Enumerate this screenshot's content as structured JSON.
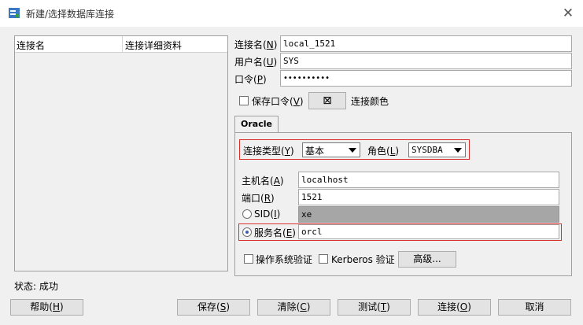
{
  "window": {
    "title": "新建/选择数据库连接",
    "close_glyph": "✕"
  },
  "connections_list": {
    "columns": [
      "连接名",
      "连接详细资料"
    ]
  },
  "form": {
    "conn_name": {
      "label": "连接名",
      "key": "N",
      "value": "local_1521"
    },
    "user_name": {
      "label": "用户名",
      "key": "U",
      "value": "SYS"
    },
    "password": {
      "label": "口令",
      "key": "P",
      "value": "••••••••••"
    },
    "save_password": {
      "label": "保存口令",
      "key": "V",
      "checked": false
    },
    "conn_color": {
      "label": "连接颜色",
      "button_glyph": "⊠"
    }
  },
  "oracle_tab": {
    "tab_label": "Oracle",
    "conn_type": {
      "label": "连接类型",
      "key": "Y",
      "value": "基本"
    },
    "role": {
      "label": "角色",
      "key": "L",
      "value": "SYSDBA"
    },
    "hostname": {
      "label": "主机名",
      "key": "A",
      "value": "localhost"
    },
    "port": {
      "label": "端口",
      "key": "R",
      "value": "1521"
    },
    "sid": {
      "label": "SID",
      "key": "I",
      "value": "xe",
      "selected": false
    },
    "service_name": {
      "label": "服务名",
      "key": "E",
      "value": "orcl",
      "selected": true
    },
    "os_auth": {
      "label": "操作系统验证",
      "checked": false
    },
    "kerberos_auth": {
      "label": "Kerberos 验证",
      "checked": false
    },
    "advanced_button": "高级..."
  },
  "status": {
    "text": "状态: 成功"
  },
  "buttons": {
    "help": {
      "label": "帮助",
      "key": "H"
    },
    "save": {
      "label": "保存",
      "key": "S"
    },
    "clear": {
      "label": "清除",
      "key": "C"
    },
    "test": {
      "label": "测试",
      "key": "T"
    },
    "connect": {
      "label": "连接",
      "key": "O"
    },
    "cancel": {
      "label": "取消"
    }
  },
  "colors": {
    "highlight": "#d9302a",
    "radio_selected": "#3a5fa8",
    "disabled_field": "#a6a6a6"
  }
}
